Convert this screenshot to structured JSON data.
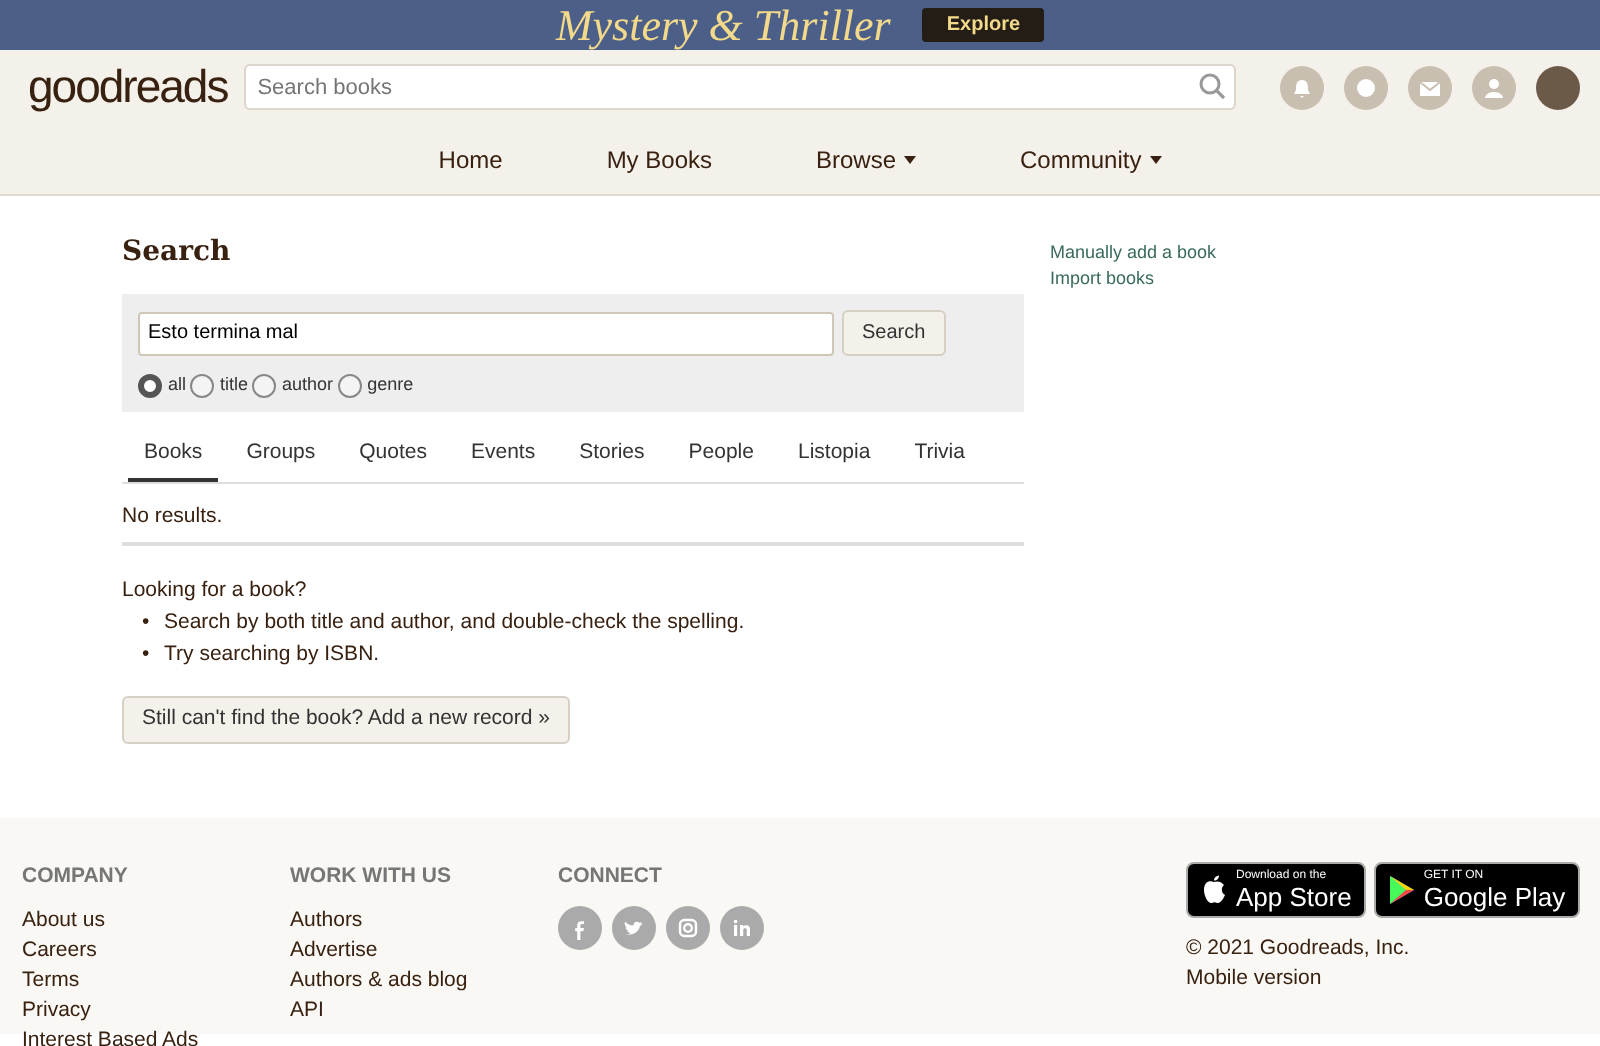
{
  "banner": {
    "title": "Mystery & Thriller",
    "button": "Explore"
  },
  "header": {
    "logo": "good**reads**",
    "search": {
      "placeholder": "Search books"
    }
  },
  "nav": [
    {
      "label": "Home",
      "dropdown": false
    },
    {
      "label": "My Books",
      "dropdown": false
    },
    {
      "label": "Browse",
      "dropdown": true
    },
    {
      "label": "Community",
      "dropdown": true
    }
  ],
  "search": {
    "title": "Search",
    "query": "Esto termina mal",
    "button": "Search",
    "filters": [
      {
        "label": "all",
        "selected": true
      },
      {
        "label": "title",
        "selected": false
      },
      {
        "label": "author",
        "selected": false
      },
      {
        "label": "genre",
        "selected": false
      }
    ]
  },
  "tabs": [
    {
      "label": "Books",
      "selected": true
    },
    {
      "label": "Groups",
      "selected": false
    },
    {
      "label": "Quotes",
      "selected": false
    },
    {
      "label": "Events",
      "selected": false
    },
    {
      "label": "Stories",
      "selected": false
    },
    {
      "label": "People",
      "selected": false
    },
    {
      "label": "Listopia",
      "selected": false
    },
    {
      "label": "Trivia",
      "selected": false
    }
  ],
  "results": "No results.",
  "help": {
    "title": "Looking for a book?",
    "tips": [
      {
        "bullet": "•",
        "text": "Search by both title and author, and double-check the spelling."
      },
      {
        "bullet": "•",
        "text": "Try searching by ISBN."
      }
    ],
    "button": "Still can't find the book? Add a new record »"
  },
  "side_links": [
    "Manually add a book",
    "Import books"
  ],
  "footer": {
    "columns": [
      {
        "title": "COMPANY",
        "links": [
          "About us",
          "Careers",
          "Terms",
          "Privacy",
          "Interest Based Ads"
        ]
      },
      {
        "title": "WORK WITH US",
        "links": [
          "Authors",
          "Advertise",
          "Authors & ads blog",
          "API"
        ]
      }
    ],
    "connect": {
      "title": "CONNECT",
      "icons": [
        {
          "kind": "facebook"
        },
        {
          "kind": "twitter"
        },
        {
          "kind": "instagram"
        },
        {
          "kind": "linkedin"
        }
      ]
    },
    "stores": [
      {
        "kind": "apple",
        "small": "Download on the",
        "big": "App Store"
      },
      {
        "kind": "google",
        "small": "GET IT ON",
        "big": "Google Play"
      }
    ],
    "copyright": "© 2021 Goodreads, Inc.",
    "mobile": "Mobile version"
  }
}
